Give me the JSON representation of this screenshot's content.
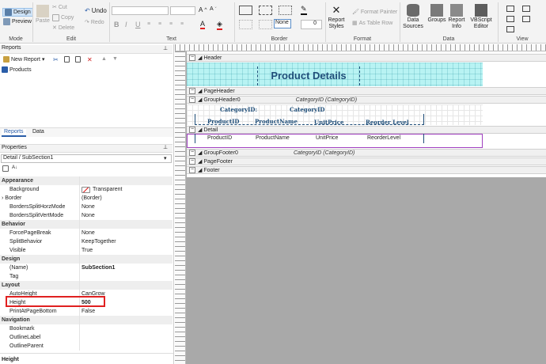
{
  "ribbon": {
    "mode": {
      "design": "Design",
      "preview": "Preview",
      "label": "Mode"
    },
    "edit": {
      "paste": "Paste",
      "cut": "Cut",
      "copy": "Copy",
      "delete": "Delete",
      "undo": "Undo",
      "redo": "Redo",
      "label": "Edit"
    },
    "text": {
      "bold": "B",
      "italic": "I",
      "underline": "U",
      "label": "Text"
    },
    "border": {
      "none": "None",
      "width": "0",
      "label": "Border"
    },
    "format": {
      "report_styles": "Report Styles",
      "format_painter": "Format Painter",
      "as_table_row": "As Table Row",
      "label": "Format"
    },
    "data": {
      "data_sources": "Data Sources",
      "groups": "Groups",
      "report_info": "Report Info",
      "vbscript_editor": "VBScript Editor",
      "label": "Data"
    },
    "view": {
      "label": "View"
    }
  },
  "reports_pane": {
    "title": "Reports",
    "new_report": "New Report",
    "items": [
      "Products"
    ],
    "tabs": [
      "Reports",
      "Data"
    ]
  },
  "properties": {
    "title": "Properties",
    "selector": "Detail / SubSection1",
    "rows": [
      {
        "cat": "Appearance"
      },
      {
        "name": "Background",
        "value": "Transparent"
      },
      {
        "name": "Border",
        "value": "(Border)"
      },
      {
        "name": "BordersSplitHorzMode",
        "value": "None"
      },
      {
        "name": "BordersSplitVertMode",
        "value": "None"
      },
      {
        "cat": "Behavior"
      },
      {
        "name": "ForcePageBreak",
        "value": "None"
      },
      {
        "name": "SplitBehavior",
        "value": "KeepTogether"
      },
      {
        "name": "Visible",
        "value": "True"
      },
      {
        "cat": "Design"
      },
      {
        "name": "(Name)",
        "value": "SubSection1"
      },
      {
        "name": "Tag",
        "value": ""
      },
      {
        "cat": "Layout"
      },
      {
        "name": "AutoHeight",
        "value": "CanGrow"
      },
      {
        "name": "Height",
        "value": "500"
      },
      {
        "name": "PrintAtPageBottom",
        "value": "False"
      },
      {
        "cat": "Navigation"
      },
      {
        "name": "Bookmark",
        "value": ""
      },
      {
        "name": "OutlineLabel",
        "value": ""
      },
      {
        "name": "OutlineParent",
        "value": ""
      }
    ],
    "footer": "Height"
  },
  "designer": {
    "bands": {
      "header": "Header",
      "page_header": "PageHeader",
      "group_header": "GroupHeader0",
      "group_header_expr": "CategoryID (CategoryID)",
      "detail": "Detail",
      "group_footer": "GroupFooter0",
      "group_footer_expr": "CategoryID (CategoryID)",
      "page_footer": "PageFooter",
      "footer": "Footer"
    },
    "title": "Product Details",
    "group_fields": {
      "label": "CategoryID:",
      "value": "CategoryID"
    },
    "columns": [
      "ProductID",
      "ProductName",
      "UnitPrice",
      "Reorder Level"
    ],
    "detail_fields": [
      "ProductID",
      "ProductName",
      "UnitPrice",
      "ReorderLevel"
    ]
  },
  "colors": {
    "header_band": "#b8f3f3",
    "title": "#1f4e79",
    "highlight": "#e02020",
    "detail_border": "#a040c0"
  }
}
